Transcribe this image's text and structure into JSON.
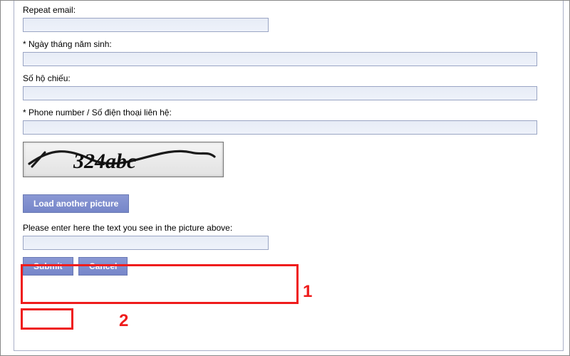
{
  "form": {
    "repeat_email_label": "Repeat email:",
    "repeat_email_value": "",
    "dob_label": "* Ngày tháng năm sinh:",
    "dob_value": "",
    "passport_label": "Số hộ chiếu:",
    "passport_value": "",
    "phone_label": "* Phone number / Số điện thoại liên hệ:",
    "phone_value": "",
    "captcha_text": "324abc",
    "load_another_label": "Load another picture",
    "captcha_instruction": "Please enter here the text you see in the picture above:",
    "captcha_input_value": "",
    "submit_label": "Submit",
    "cancel_label": "Cancel"
  },
  "annotations": {
    "mark1": "1",
    "mark2": "2"
  }
}
